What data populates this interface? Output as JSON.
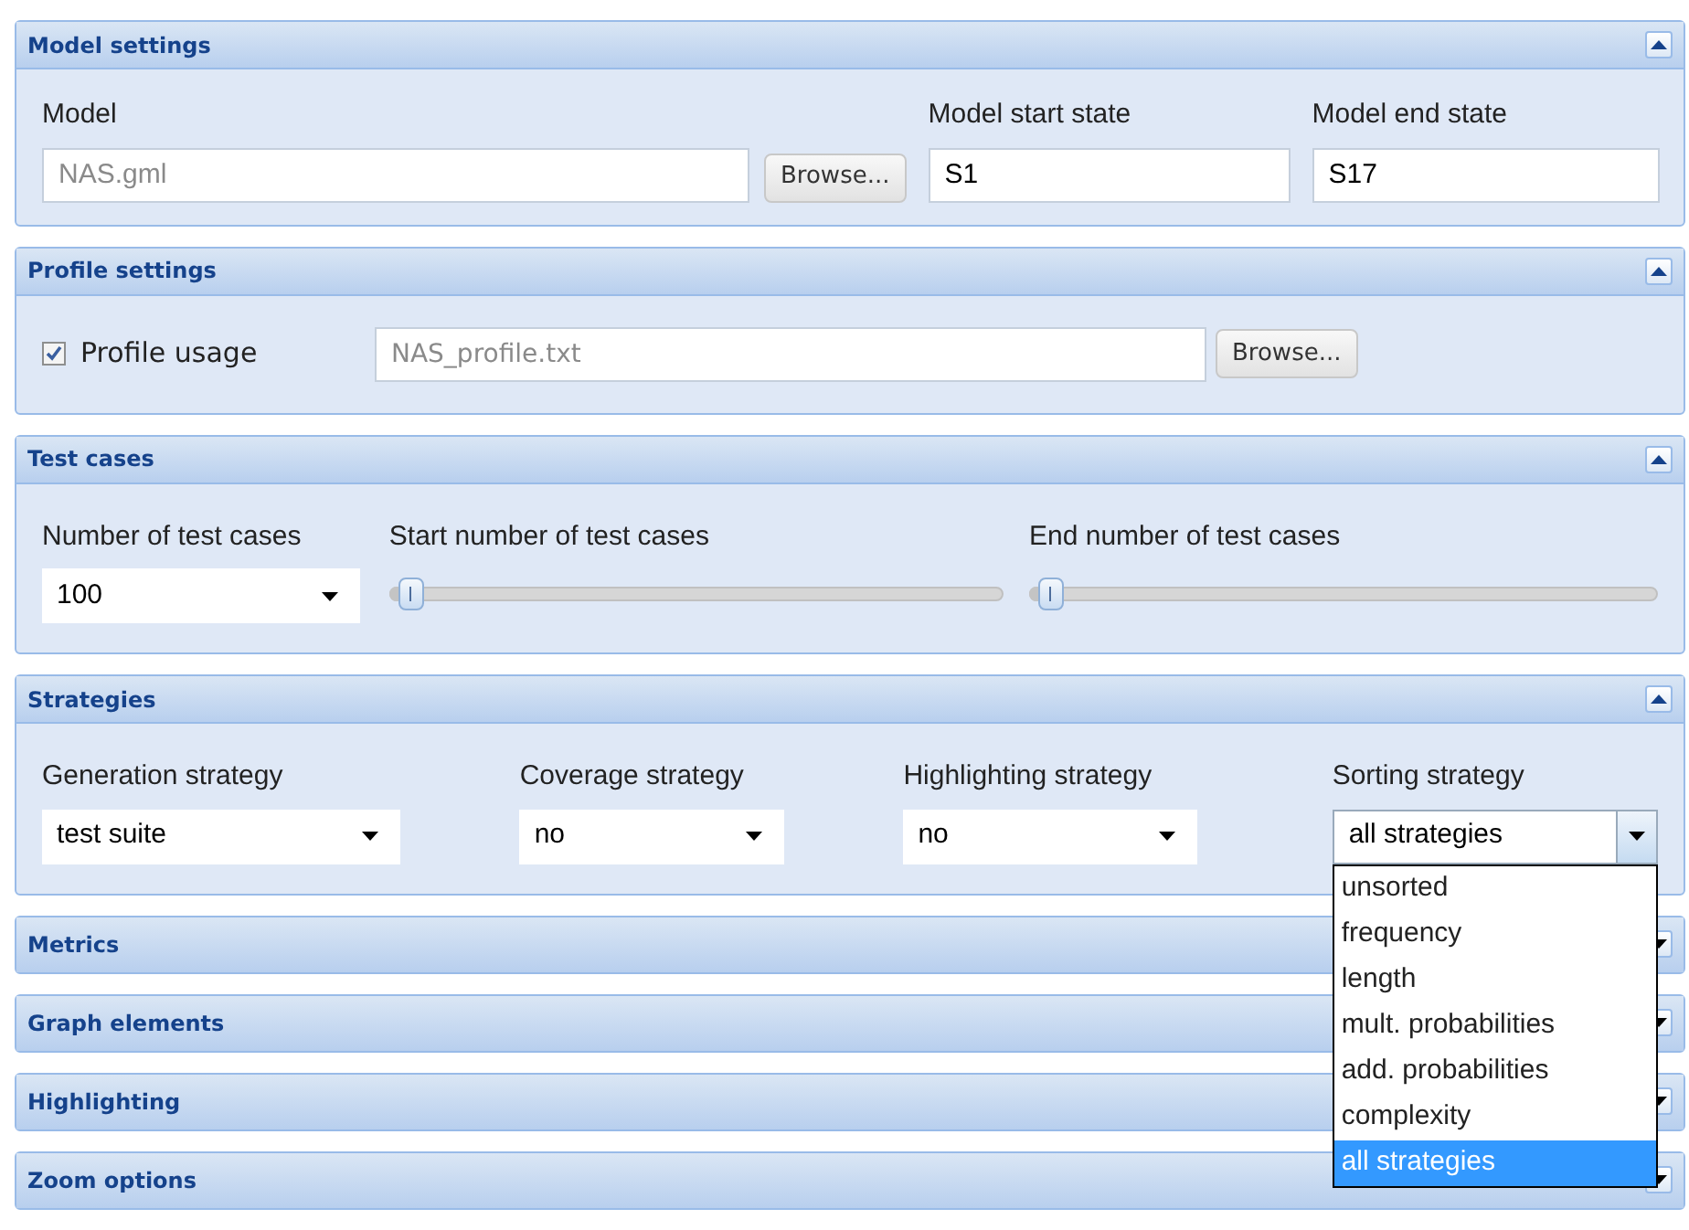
{
  "panels": [
    {
      "kind": "model",
      "title": "Model settings",
      "expanded": true,
      "model": {
        "label": "Model",
        "value": "NAS.gml",
        "disabled": true
      },
      "browse": "Browse...",
      "start": {
        "label": "Model start state",
        "value": "S1",
        "disabled": false
      },
      "end": {
        "label": "Model end state",
        "value": "S17",
        "disabled": false
      }
    },
    {
      "kind": "profile",
      "title": "Profile settings",
      "expanded": true,
      "checkbox": {
        "label": "Profile usage",
        "checked": true
      },
      "file": {
        "value": "NAS_profile.txt",
        "disabled": true
      },
      "browse": "Browse..."
    },
    {
      "kind": "testcases",
      "title": "Test cases",
      "expanded": true,
      "count": {
        "label": "Number of test cases",
        "value": "100"
      },
      "sliders": [
        {
          "label": "Start number of test cases",
          "level": 0.02
        },
        {
          "label": "End number of test cases",
          "level": 0.02
        }
      ]
    },
    {
      "kind": "strategies",
      "title": "Strategies",
      "expanded": true,
      "selects": [
        {
          "label": "Generation strategy",
          "value": "test suite",
          "open": false
        },
        {
          "label": "Coverage strategy",
          "value": "no",
          "open": false
        },
        {
          "label": "Highlighting strategy",
          "value": "no",
          "open": false
        },
        {
          "label": "Sorting strategy",
          "value": "all strategies",
          "open": true,
          "options": [
            {
              "label": "unsorted",
              "selected": false
            },
            {
              "label": "frequency",
              "selected": false
            },
            {
              "label": "length",
              "selected": false
            },
            {
              "label": "mult. probabilities",
              "selected": false
            },
            {
              "label": "add. probabilities",
              "selected": false
            },
            {
              "label": "complexity",
              "selected": false
            },
            {
              "label": "all strategies",
              "selected": true
            }
          ]
        }
      ]
    },
    {
      "title": "Metrics",
      "expanded": false
    },
    {
      "title": "Graph elements",
      "expanded": false
    },
    {
      "title": "Highlighting",
      "expanded": false
    },
    {
      "title": "Zoom options",
      "expanded": false
    }
  ]
}
